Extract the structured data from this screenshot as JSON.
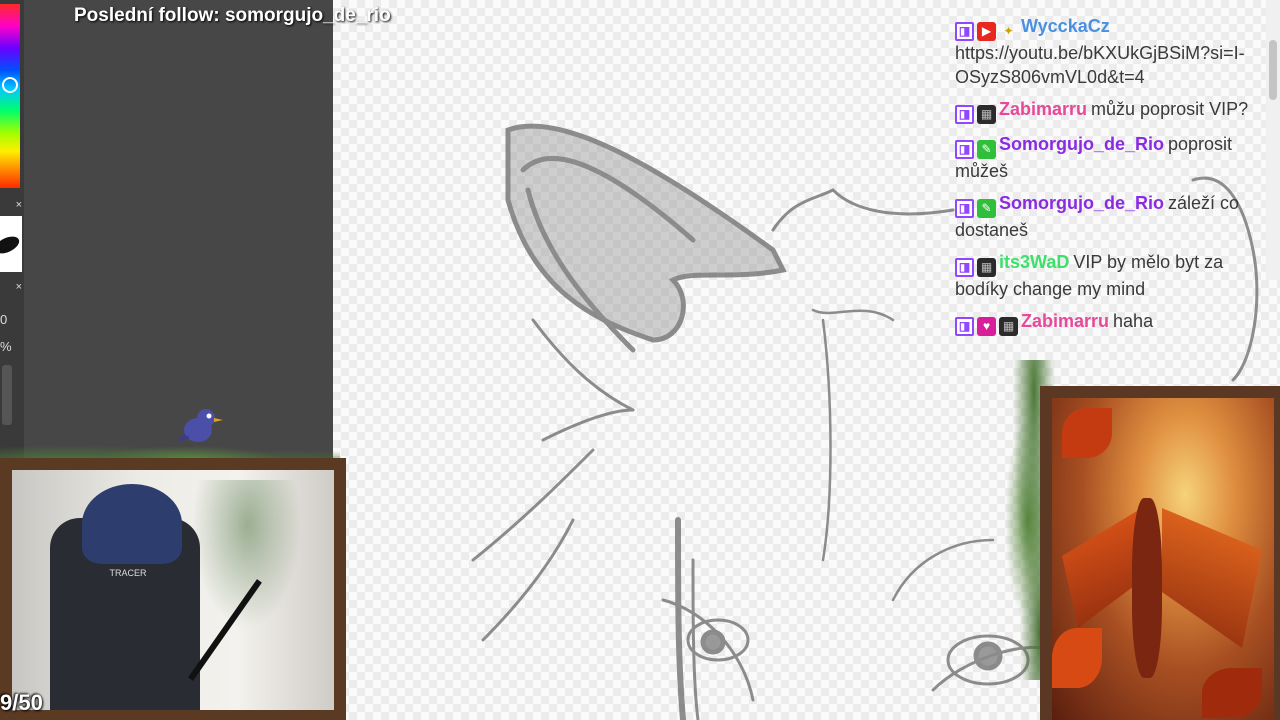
{
  "overlay": {
    "last_follow": "Poslední follow: somorgujo_de_rio",
    "goal_counter": "9/50"
  },
  "tool_panel": {
    "opacity_value": "0",
    "percent_label": "%",
    "close_glyph": "×"
  },
  "webcam": {
    "chair_brand": "TRACER"
  },
  "chat": {
    "messages": [
      {
        "user": "WycckaCz",
        "user_color": "#4a90e2",
        "badges": [
          "twitch-icon",
          "youtube-badge-icon",
          "star-badge-icon"
        ],
        "text": "https://youtu.be/bKXUkGjBSiM?si=I-OSyzS806vmVL0d&t=4"
      },
      {
        "user": "Zabimarru",
        "user_color": "#e8489a",
        "badges": [
          "twitch-icon",
          "pixel-badge-icon"
        ],
        "text": "můžu poprosit VIP?"
      },
      {
        "user": "Somorgujo_de_Rio",
        "user_color": "#8a2be2",
        "badges": [
          "twitch-icon",
          "pencil-badge-icon"
        ],
        "text": "poprosit můžeš"
      },
      {
        "user": "Somorgujo_de_Rio",
        "user_color": "#8a2be2",
        "badges": [
          "twitch-icon",
          "pencil-badge-icon"
        ],
        "text": "záleží co dostaneš"
      },
      {
        "user": "its3WaD",
        "user_color": "#3ce06a",
        "badges": [
          "twitch-icon",
          "pixel-badge-icon"
        ],
        "text": "VIP by mělo byt za bodíky change my mind"
      },
      {
        "user": "Zabimarru",
        "user_color": "#e8489a",
        "badges": [
          "twitch-icon",
          "heart-badge-icon",
          "pixel-badge-icon"
        ],
        "text": "haha"
      }
    ]
  },
  "colors": {
    "twitch": "#9146ff",
    "frame_wood": "#5b3a23",
    "vine_green": "#4e7a3a"
  }
}
